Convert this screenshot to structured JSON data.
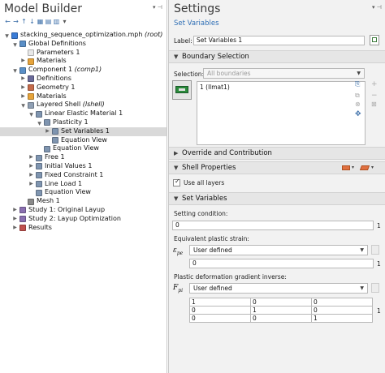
{
  "model_builder": {
    "title": "Model Builder",
    "pin": "▾ ⊣",
    "toolbar_icons": [
      "arrow-left-icon",
      "arrow-right-icon",
      "arrow-up-icon",
      "arrow-down-icon",
      "show-icon",
      "collapse-icon",
      "expand-icon",
      "menu-icon"
    ],
    "tree": [
      {
        "label": "stacking_sequence_optimization.mph",
        "suffix": " (root)",
        "indent": 0,
        "arrow": "down",
        "icon": "root-file-icon",
        "color": "#3b7dd8"
      },
      {
        "label": "Global Definitions",
        "indent": 1,
        "arrow": "down",
        "icon": "globe-icon",
        "color": "#5a8fc7"
      },
      {
        "label": "Parameters 1",
        "indent": 2,
        "arrow": "",
        "icon": "parameters-icon",
        "color": "#e8e8e8"
      },
      {
        "label": "Materials",
        "indent": 2,
        "arrow": "right",
        "icon": "materials-icon",
        "color": "#e6a33a"
      },
      {
        "label": "Component 1",
        "suffix": " (comp1)",
        "indent": 1,
        "arrow": "down",
        "icon": "component-icon",
        "color": "#5a8fc7"
      },
      {
        "label": "Definitions",
        "indent": 2,
        "arrow": "right",
        "icon": "definitions-icon",
        "color": "#6a6a9a"
      },
      {
        "label": "Geometry 1",
        "indent": 2,
        "arrow": "right",
        "icon": "geometry-icon",
        "color": "#c46a4a"
      },
      {
        "label": "Materials",
        "indent": 2,
        "arrow": "right",
        "icon": "materials-icon",
        "color": "#e6a33a"
      },
      {
        "label": "Layered Shell",
        "suffix": " (lshell)",
        "indent": 2,
        "arrow": "down",
        "icon": "layered-shell-icon",
        "color": "#8f9fb3"
      },
      {
        "label": "Linear Elastic Material 1",
        "indent": 3,
        "arrow": "down",
        "icon": "material-model-icon",
        "color": "#7f95b0"
      },
      {
        "label": "Plasticity 1",
        "indent": 4,
        "arrow": "down",
        "icon": "plasticity-icon",
        "color": "#7f95b0"
      },
      {
        "label": "Set Variables 1",
        "indent": 5,
        "arrow": "right",
        "icon": "set-variables-icon",
        "color": "#7f95b0",
        "selected": true
      },
      {
        "label": "Equation View",
        "indent": 5,
        "arrow": "",
        "icon": "equation-view-icon",
        "color": "#7f95b0"
      },
      {
        "label": "Equation View",
        "indent": 4,
        "arrow": "",
        "icon": "equation-view-icon",
        "color": "#7f95b0"
      },
      {
        "label": "Free 1",
        "indent": 3,
        "arrow": "right",
        "icon": "free-icon",
        "color": "#7f95b0"
      },
      {
        "label": "Initial Values 1",
        "indent": 3,
        "arrow": "right",
        "icon": "initial-values-icon",
        "color": "#7f95b0"
      },
      {
        "label": "Fixed Constraint 1",
        "indent": 3,
        "arrow": "right",
        "icon": "fixed-constraint-icon",
        "color": "#7f95b0"
      },
      {
        "label": "Line Load 1",
        "indent": 3,
        "arrow": "right",
        "icon": "line-load-icon",
        "color": "#7f95b0"
      },
      {
        "label": "Equation View",
        "indent": 3,
        "arrow": "",
        "icon": "equation-view-icon",
        "color": "#7f95b0"
      },
      {
        "label": "Mesh 1",
        "indent": 2,
        "arrow": "",
        "icon": "mesh-icon",
        "color": "#8a8a8a"
      },
      {
        "label": "Study 1: Original Layup",
        "indent": 1,
        "arrow": "right",
        "icon": "study-icon",
        "color": "#8a6fb0"
      },
      {
        "label": "Study 2: Layup Optimization",
        "indent": 1,
        "arrow": "right",
        "icon": "study-icon",
        "color": "#8a6fb0"
      },
      {
        "label": "Results",
        "indent": 1,
        "arrow": "right",
        "icon": "results-icon",
        "color": "#c0504d"
      }
    ]
  },
  "settings": {
    "title": "Settings",
    "subtitle": "Set Variables",
    "pin": "▾ ⊣",
    "label_caption": "Label:",
    "label_value": "Set Variables 1",
    "sections": {
      "boundary_selection": "Boundary Selection",
      "override": "Override and Contribution",
      "shell_properties": "Shell Properties",
      "set_variables": "Set Variables"
    },
    "selection_caption": "Selection:",
    "selection_value": "All boundaries",
    "selection_list": [
      "1 (llmat1)"
    ],
    "use_all_layers": "Use all layers",
    "setting_condition_caption": "Setting condition:",
    "setting_condition_value": "0",
    "setting_condition_unit": "1",
    "eq_plastic_strain_caption": "Equivalent plastic strain:",
    "eq_symbol": "ε",
    "eq_symbol_sub": "pe",
    "eq_dropdown": "User defined",
    "eq_value": "0",
    "eq_unit": "1",
    "pdg_caption": "Plastic deformation gradient inverse:",
    "pdg_symbol": "F",
    "pdg_symbol_sub": "pi",
    "pdg_dropdown": "User defined",
    "pdg_matrix": [
      [
        "1",
        "0",
        "0"
      ],
      [
        "0",
        "1",
        "0"
      ],
      [
        "0",
        "0",
        "1"
      ]
    ],
    "pdg_unit": "1"
  }
}
